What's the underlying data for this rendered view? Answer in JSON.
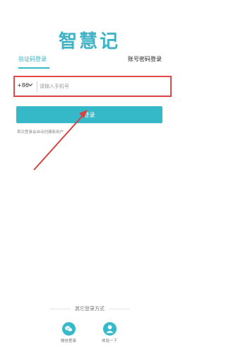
{
  "app": {
    "logo_text": "智慧记"
  },
  "tabs": [
    {
      "label": "验证码登录",
      "active": true
    },
    {
      "label": "账号密码登录",
      "active": false
    }
  ],
  "phone": {
    "country_code": "+86",
    "placeholder": "请输入手机号",
    "value": ""
  },
  "login": {
    "button_label": "登录",
    "hint": "首次登录会自动创建新用户"
  },
  "other_login": {
    "title": "其它登录方式",
    "options": [
      {
        "label": "微信登录",
        "icon": "wechat-icon"
      },
      {
        "label": "体验一下",
        "icon": "user-icon"
      }
    ]
  },
  "colors": {
    "accent": "#35b9c8",
    "highlight": "#e24a4a"
  }
}
